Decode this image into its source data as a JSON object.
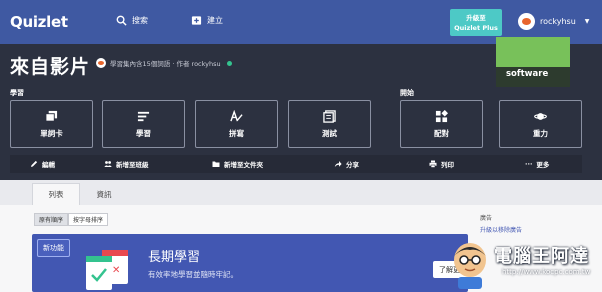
{
  "header": {
    "logo": "Quizlet",
    "search_label": "搜索",
    "create_label": "建立",
    "upgrade_line1": "升級至",
    "upgrade_line2": "Quizlet Plus",
    "username": "rockyhsu"
  },
  "set": {
    "title": "來自影片",
    "meta": "學習集內含15個詞語 · 作者 rockyhsu"
  },
  "study": {
    "label": "學習",
    "modes": [
      "單詞卡",
      "學習",
      "拼寫",
      "測試"
    ]
  },
  "play": {
    "label": "開始",
    "modes": [
      "配對",
      "重力"
    ]
  },
  "toolbar": {
    "edit": "編輯",
    "add_class": "新增至班級",
    "add_folder": "新增至文件夾",
    "share": "分享",
    "print": "列印",
    "more": "更多"
  },
  "tabs": {
    "list": "列表",
    "info": "資訊"
  },
  "sort": {
    "original": "原有順序",
    "alpha": "按字母排序"
  },
  "promo": {
    "badge": "新功能",
    "title": "長期學習",
    "subtitle": "有效率地學習並隨時牢記。",
    "button": "了解更多"
  },
  "ad": {
    "label": "廣告",
    "remove_link": "升級以移除廣告",
    "text": "software"
  },
  "watermark": {
    "title": "電腦王阿達",
    "url": "http://www.kocpc.com.tw"
  },
  "colors": {
    "header_bg": "#3f59a2",
    "dark_bg": "#2c3140",
    "upgrade": "#4dc9c6",
    "promo_bg": "#4257b2"
  }
}
